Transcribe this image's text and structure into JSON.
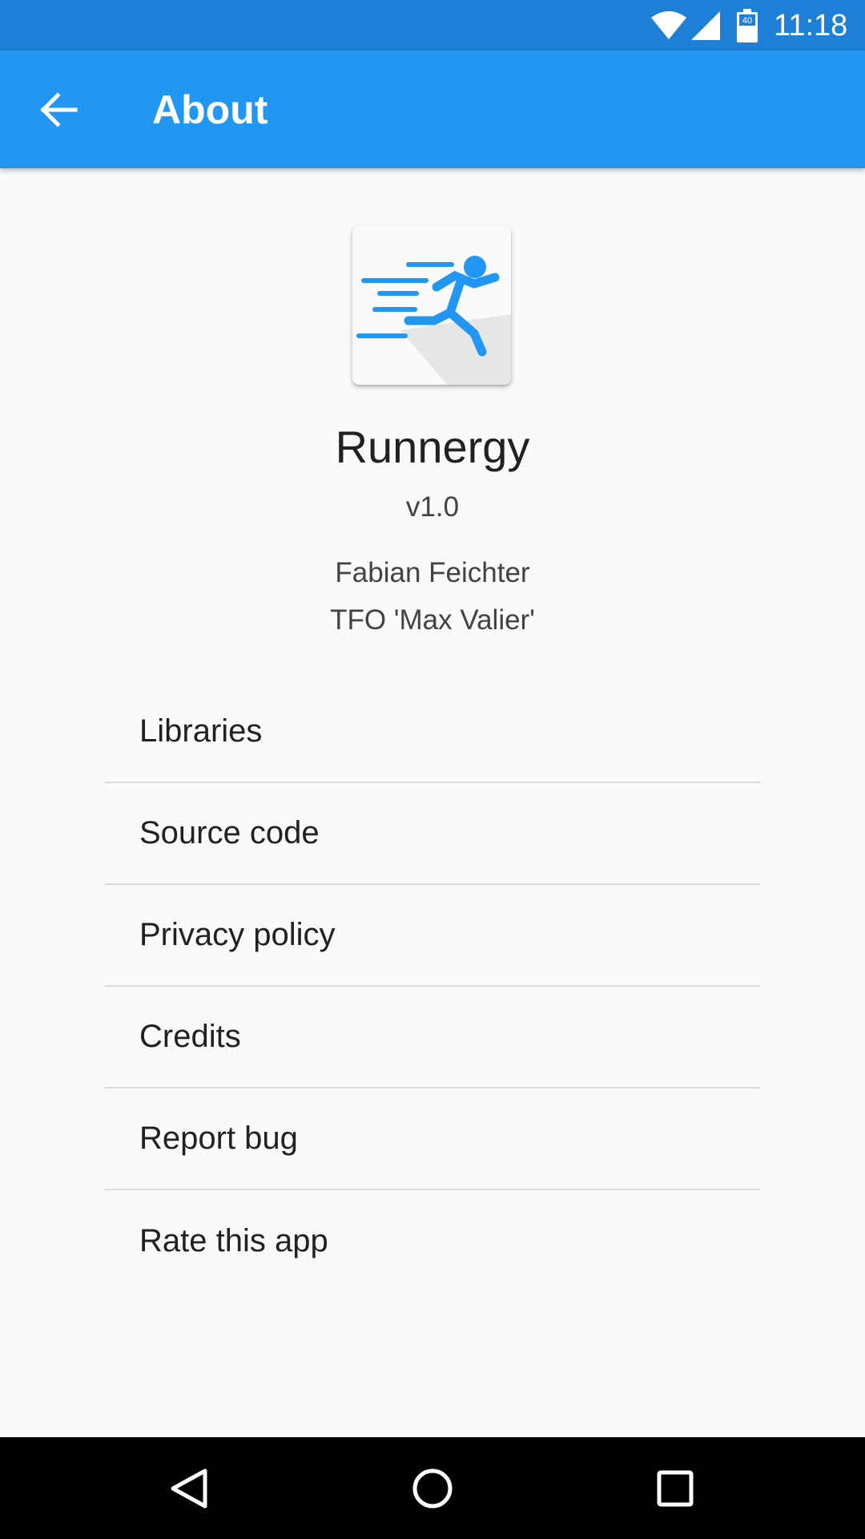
{
  "status_bar": {
    "time": "11:18",
    "icons": [
      "wifi-icon",
      "cell-signal-icon",
      "battery-icon"
    ],
    "battery_label": "40"
  },
  "app_bar": {
    "title": "About",
    "back_icon": "arrow-back-icon"
  },
  "app_info": {
    "icon": "running-person-icon",
    "name": "Runnergy",
    "version": "v1.0",
    "author": "Fabian Feichter",
    "organization": "TFO 'Max Valier'"
  },
  "menu": {
    "items": [
      {
        "label": "Libraries"
      },
      {
        "label": "Source code"
      },
      {
        "label": "Privacy policy"
      },
      {
        "label": "Credits"
      },
      {
        "label": "Report bug"
      },
      {
        "label": "Rate this app"
      }
    ]
  },
  "nav_bar": {
    "icons": [
      "back-triangle-icon",
      "home-circle-icon",
      "recents-square-icon"
    ]
  },
  "colors": {
    "status_bar": "#1E7FD6",
    "app_bar": "#2196F3",
    "background": "#FAFAFA",
    "icon_blue": "#2196F3"
  }
}
